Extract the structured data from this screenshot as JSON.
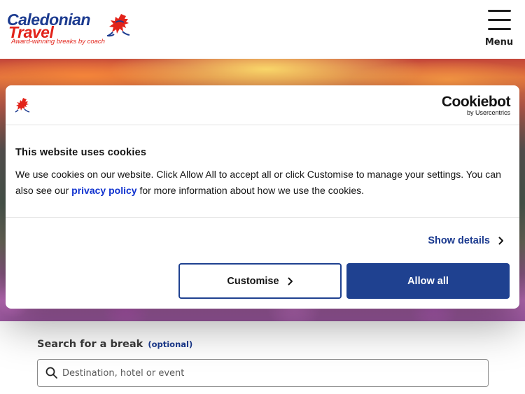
{
  "header": {
    "logo": {
      "line1": "Caledonian",
      "line2": "Travel",
      "tagline": "Award-winning breaks by coach"
    },
    "menu_label": "Menu"
  },
  "cookie_banner": {
    "brand_main": "Cookiebot",
    "brand_sub": "by Usercentrics",
    "title": "This website uses cookies",
    "text_before_link": "We use cookies on our website. Click Allow All to accept all or click Customise to manage your settings. You can also see our ",
    "link_text": "privacy policy",
    "text_after_link": " for more information about how we use the cookies.",
    "show_details_label": "Show details",
    "customise_label": "Customise",
    "allow_all_label": "Allow all",
    "accent_color": "#1f4190"
  },
  "search": {
    "label": "Search for a break",
    "label_optional": "(optional)",
    "placeholder": "Destination, hotel or event",
    "value": ""
  },
  "colors": {
    "brand_blue": "#1b3a8f",
    "brand_red": "#e2231a",
    "link_blue": "#1032cf"
  },
  "icons": {
    "menu": "hamburger-icon",
    "search": "search-icon",
    "chevron": "chevron-right-icon",
    "logo_mark": "lion-rampant-icon"
  }
}
